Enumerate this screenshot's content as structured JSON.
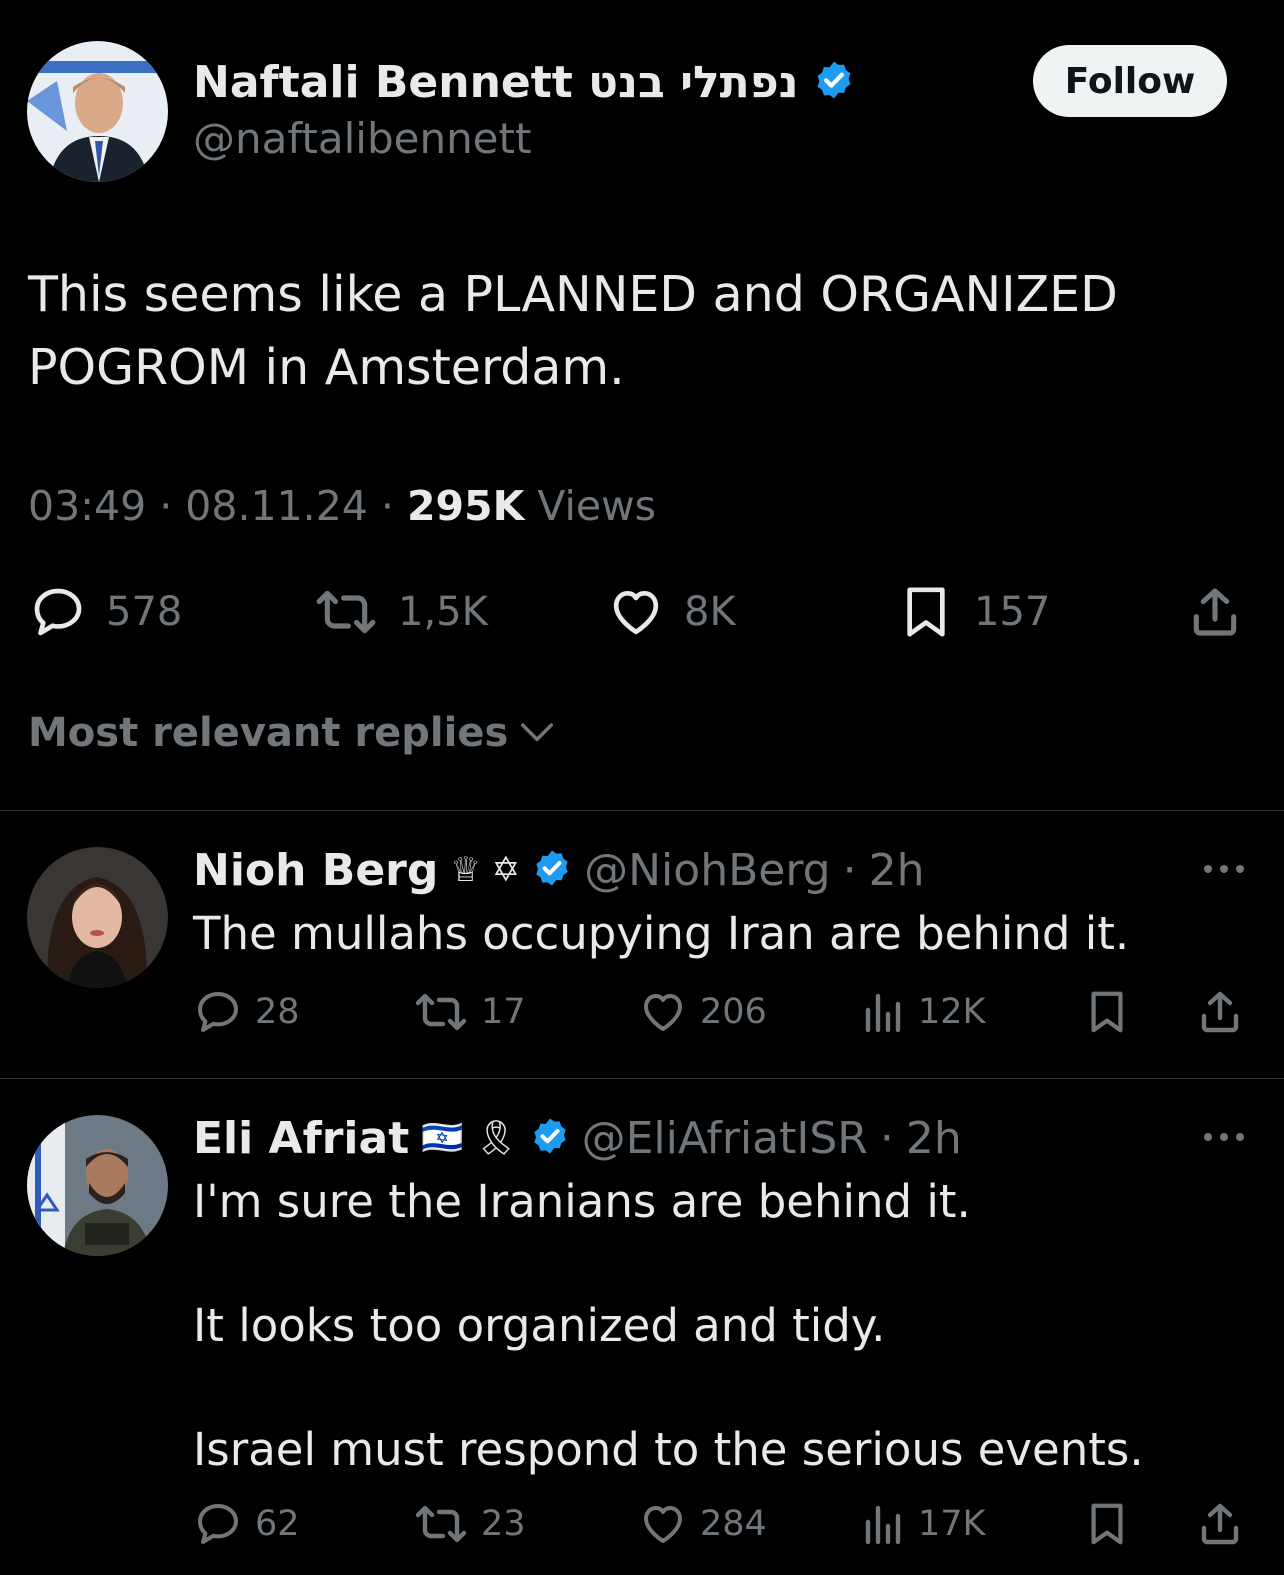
{
  "main_tweet": {
    "author_name": "Naftali Bennett נפתלי בנט",
    "handle": "@naftalibennett",
    "follow_label": "Follow",
    "text": "This seems like a PLANNED and ORGANIZED POGROM in Amsterdam.",
    "time": "03:49",
    "date": "08.11.24",
    "views_count": "295K",
    "views_label": "Views",
    "replies": "578",
    "reposts": "1,5K",
    "likes": "8K",
    "bookmarks": "157"
  },
  "sort": {
    "label": "Most relevant replies"
  },
  "replies": [
    {
      "name": "Nioh Berg",
      "badges": "♕ ✡",
      "handle": "@NiohBerg",
      "age": "2h",
      "text": "The mullahs occupying Iran are behind it.",
      "replies": "28",
      "reposts": "17",
      "likes": "206",
      "views": "12K"
    },
    {
      "name": "Eli Afriat",
      "badges": "🇮🇱 🎗",
      "handle": "@EliAfriatISR",
      "age": "2h",
      "text": "I'm sure the Iranians are behind it.\n\nIt looks too organized and tidy.\n\nIsrael must respond to the serious events.",
      "replies": "62",
      "reposts": "23",
      "likes": "284",
      "views": "17K"
    }
  ],
  "colors": {
    "background": "#000000",
    "text_primary": "#e7e9ea",
    "text_muted": "#71767b",
    "verified_blue": "#1d9bf0",
    "divider": "#2f3336",
    "follow_bg": "#eff3f4"
  }
}
